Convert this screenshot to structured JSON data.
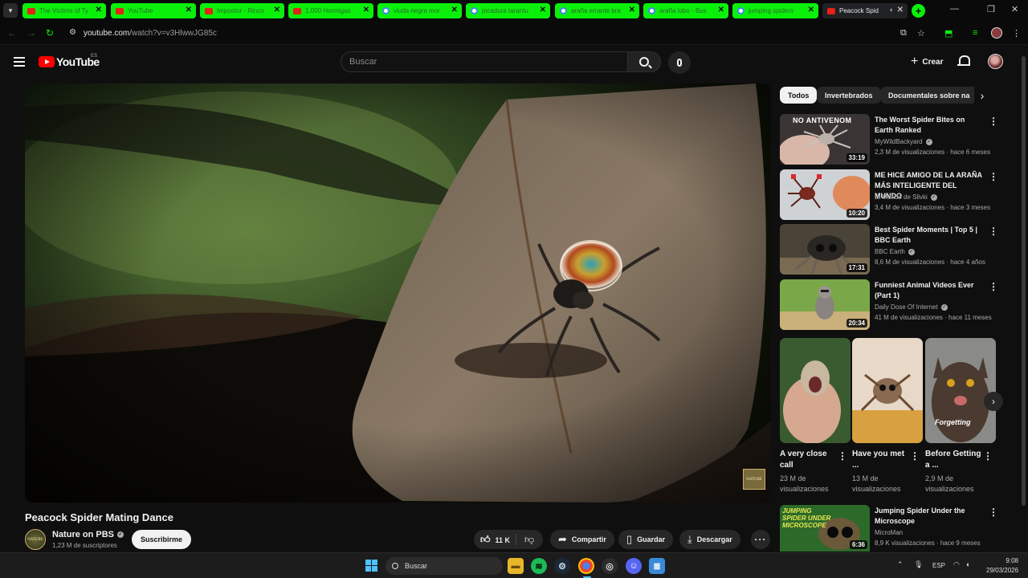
{
  "browser": {
    "tabs": [
      {
        "title": "The Victims of Ty",
        "favicon": "youtube-icon"
      },
      {
        "title": "YouTube",
        "favicon": "youtube-icon"
      },
      {
        "title": "Impostor - Rinco",
        "favicon": "youtube-icon"
      },
      {
        "title": "1,000 Hormigas",
        "favicon": "youtube-icon"
      },
      {
        "title": "viuda negra mor",
        "favicon": "google-icon"
      },
      {
        "title": "picadura tarantu",
        "favicon": "google-icon"
      },
      {
        "title": "araña errante bra",
        "favicon": "google-icon"
      },
      {
        "title": "araña lobo - Bus",
        "favicon": "google-icon"
      },
      {
        "title": "jumping spiders",
        "favicon": "google-icon"
      },
      {
        "title": "Peacock Spid",
        "favicon": "youtube-icon",
        "active": true
      }
    ],
    "url_host": "youtube.com",
    "url_path": "/watch?v=v3HlwwJG85c",
    "accent_color": "#0bf00b"
  },
  "header": {
    "logo_text": "YouTube",
    "region": "ES",
    "search_placeholder": "Buscar",
    "create_label": "Crear"
  },
  "video": {
    "title": "Peacock Spider Mating Dance",
    "channel": "Nature on PBS",
    "subscribers": "1,23 M de suscriptores",
    "subscribe_label": "Suscribirme",
    "likes": "11 K",
    "share_label": "Compartir",
    "save_label": "Guardar",
    "download_label": "Descargar",
    "watermark": "NATURE"
  },
  "sidebar": {
    "chips": [
      "Todos",
      "Invertebrados",
      "Documentales sobre na"
    ],
    "recommendations": [
      {
        "title": "The Worst Spider Bites on Earth Ranked",
        "channel": "MyWildBackyard",
        "meta": "2,3 M de visualizaciones · hace 6 meses",
        "duration": "33:19",
        "thumb_text": "NO ANTIVENOM"
      },
      {
        "title": "ME HICE AMIGO DE LA ARAÑA MÁS INTELIGENTE DEL MUNDO",
        "channel": "El Mundo de Slivki",
        "meta": "3,4 M de visualizaciones · hace 3 meses",
        "duration": "10:20",
        "thumb_text": ""
      },
      {
        "title": "Best Spider Moments | Top 5 | BBC Earth",
        "channel": "BBC Earth",
        "meta": "8,6 M de visualizaciones · hace 4 años",
        "duration": "17:31",
        "thumb_text": ""
      },
      {
        "title": "Funniest Animal Videos Ever (Part 1)",
        "channel": "Daily Dose Of Internet",
        "meta": "41 M de visualizaciones · hace 11 meses",
        "duration": "20:34",
        "thumb_text": ""
      }
    ],
    "shorts": [
      {
        "title": "A very close call",
        "views": "23 M de visualizaciones",
        "thumb_text": ""
      },
      {
        "title": "Have you met ...",
        "views": "13 M de visualizaciones",
        "thumb_text": ""
      },
      {
        "title": "Before Getting a ...",
        "views": "2,9 M de visualizaciones",
        "thumb_text": "Forgetting"
      }
    ],
    "last_rec": {
      "title": "Jumping Spider Under the Microscope",
      "channel": "MicroMan",
      "meta": "8,9 K visualizaciones · hace 9 meses",
      "duration": "6:36",
      "thumb_text": "JUMPING SPIDER UNDER MICROSCOPE"
    }
  },
  "taskbar": {
    "search_label": "Buscar",
    "language": "ESP",
    "time": "9:08",
    "date": "29/03/2026"
  }
}
